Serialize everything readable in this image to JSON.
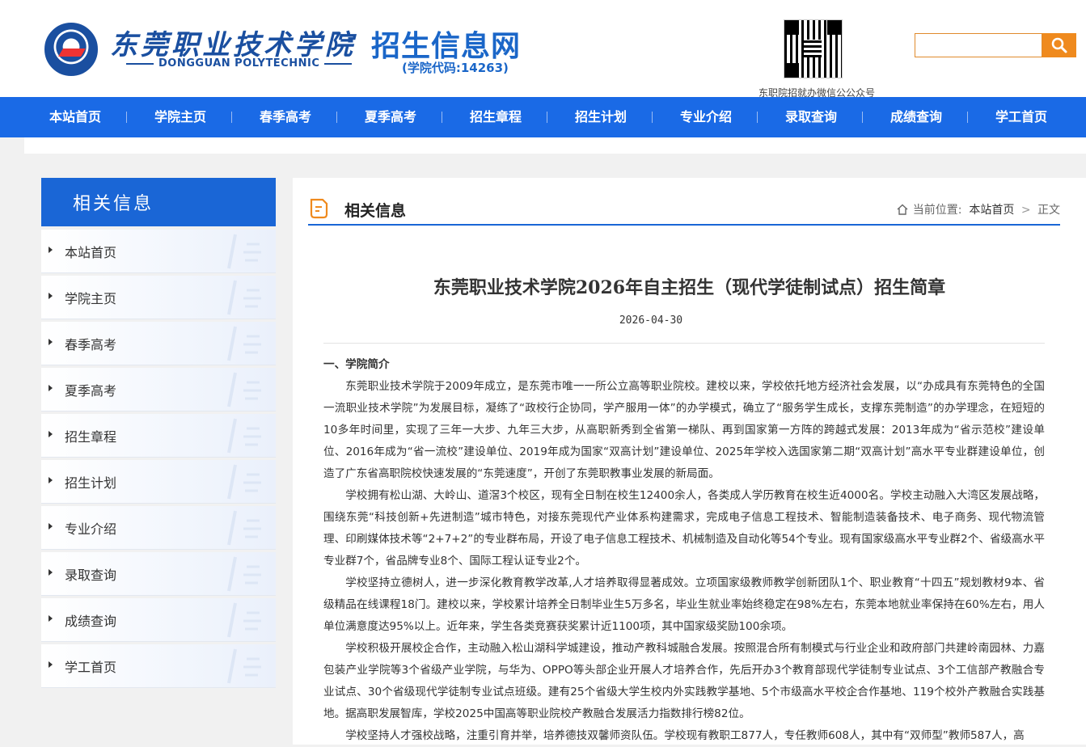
{
  "header": {
    "school_cn": "东莞职业技术学院",
    "school_en": "DONGGUAN POLYTECHNIC",
    "dot": "·",
    "site_title": "招生信息网",
    "site_code": "(学院代码:14263)",
    "qr_caption": "东职院招就办微信公公众号",
    "search_placeholder": ""
  },
  "nav": {
    "items": [
      "本站首页",
      "学院主页",
      "春季高考",
      "夏季高考",
      "招生章程",
      "招生计划",
      "专业介绍",
      "录取查询",
      "成绩查询",
      "学工首页"
    ]
  },
  "sidebar": {
    "title": "相关信息",
    "items": [
      "本站首页",
      "学院主页",
      "春季高考",
      "夏季高考",
      "招生章程",
      "招生计划",
      "专业介绍",
      "录取查询",
      "成绩查询",
      "学工首页"
    ]
  },
  "main": {
    "heading": "相关信息",
    "breadcrumb": {
      "label": "当前位置:",
      "home": "本站首页",
      "sep": ">",
      "current": "正文"
    },
    "article": {
      "title": "东莞职业技术学院2026年自主招生（现代学徒制试点）招生简章",
      "date": "2026-04-30",
      "section1": "一、学院简介",
      "paragraphs": [
        "东莞职业技术学院于2009年成立，是东莞市唯一一所公立高等职业院校。建校以来，学校依托地方经济社会发展，以“办成具有东莞特色的全国一流职业技术学院”为发展目标，凝练了“政校行企协同，学产服用一体”的办学模式，确立了“服务学生成长，支撑东莞制造”的办学理念，在短短的10多年时间里，实现了三年一大步、九年三大步，从高职新秀到全省第一梯队、再到国家第一方阵的跨越式发展：2013年成为“省示范校”建设单位、2016年成为“省一流校”建设单位、2019年成为国家“双高计划”建设单位、2025年学校入选国家第二期“双高计划”高水平专业群建设单位，创造了广东省高职院校快速发展的“东莞速度”，开创了东莞职教事业发展的新局面。",
        "学校拥有松山湖、大岭山、道滘3个校区，现有全日制在校生12400余人，各类成人学历教育在校生近4000名。学校主动融入大湾区发展战略，围绕东莞“科技创新+先进制造”城市特色，对接东莞现代产业体系构建需求，完成电子信息工程技术、智能制造装备技术、电子商务、现代物流管理、印刷媒体技术等“2+7+2”的专业群布局，开设了电子信息工程技术、机械制造及自动化等54个专业。现有国家级高水平专业群2个、省级高水平专业群7个，省品牌专业8个、国际工程认证专业2个。",
        "学校坚持立德树人，进一步深化教育教学改革,人才培养取得显著成效。立项国家级教师教学创新团队1个、职业教育“十四五”规划教材9本、省级精品在线课程18门。建校以来，学校累计培养全日制毕业生5万多名，毕业生就业率始终稳定在98%左右，东莞本地就业率保持在60%左右，用人单位满意度达95%以上。近年来，学生各类竞赛获奖累计近1100项，其中国家级奖励100余项。",
        "学校积极开展校企合作，主动融入松山湖科学城建设，推动产教科城融合发展。按照混合所有制模式与行业企业和政府部门共建岭南园林、力嘉包装产业学院等3个省级产业学院，与华为、OPPO等头部企业开展人才培养合作，先后开办3个教育部现代学徒制专业试点、3个工信部产教融合专业试点、30个省级现代学徒制专业试点班级。建有25个省级大学生校内外实践教学基地、5个市级高水平校企合作基地、119个校外产教融合实践基地。据高职发展智库，学校2025中国高等职业院校产教融合发展活力指数排行榜82位。",
        "学校坚持人才强校战略，注重引育并举，培养德技双馨师资队伍。学校现有教职工877人，专任教师608人，其中有“双师型”教师587人，高"
      ]
    }
  },
  "colors": {
    "nav_bg": "#1a6ae6",
    "brand": "#1a66c8",
    "search_btn": "#ef8a1e",
    "page_bg": "#f1f1f1"
  }
}
